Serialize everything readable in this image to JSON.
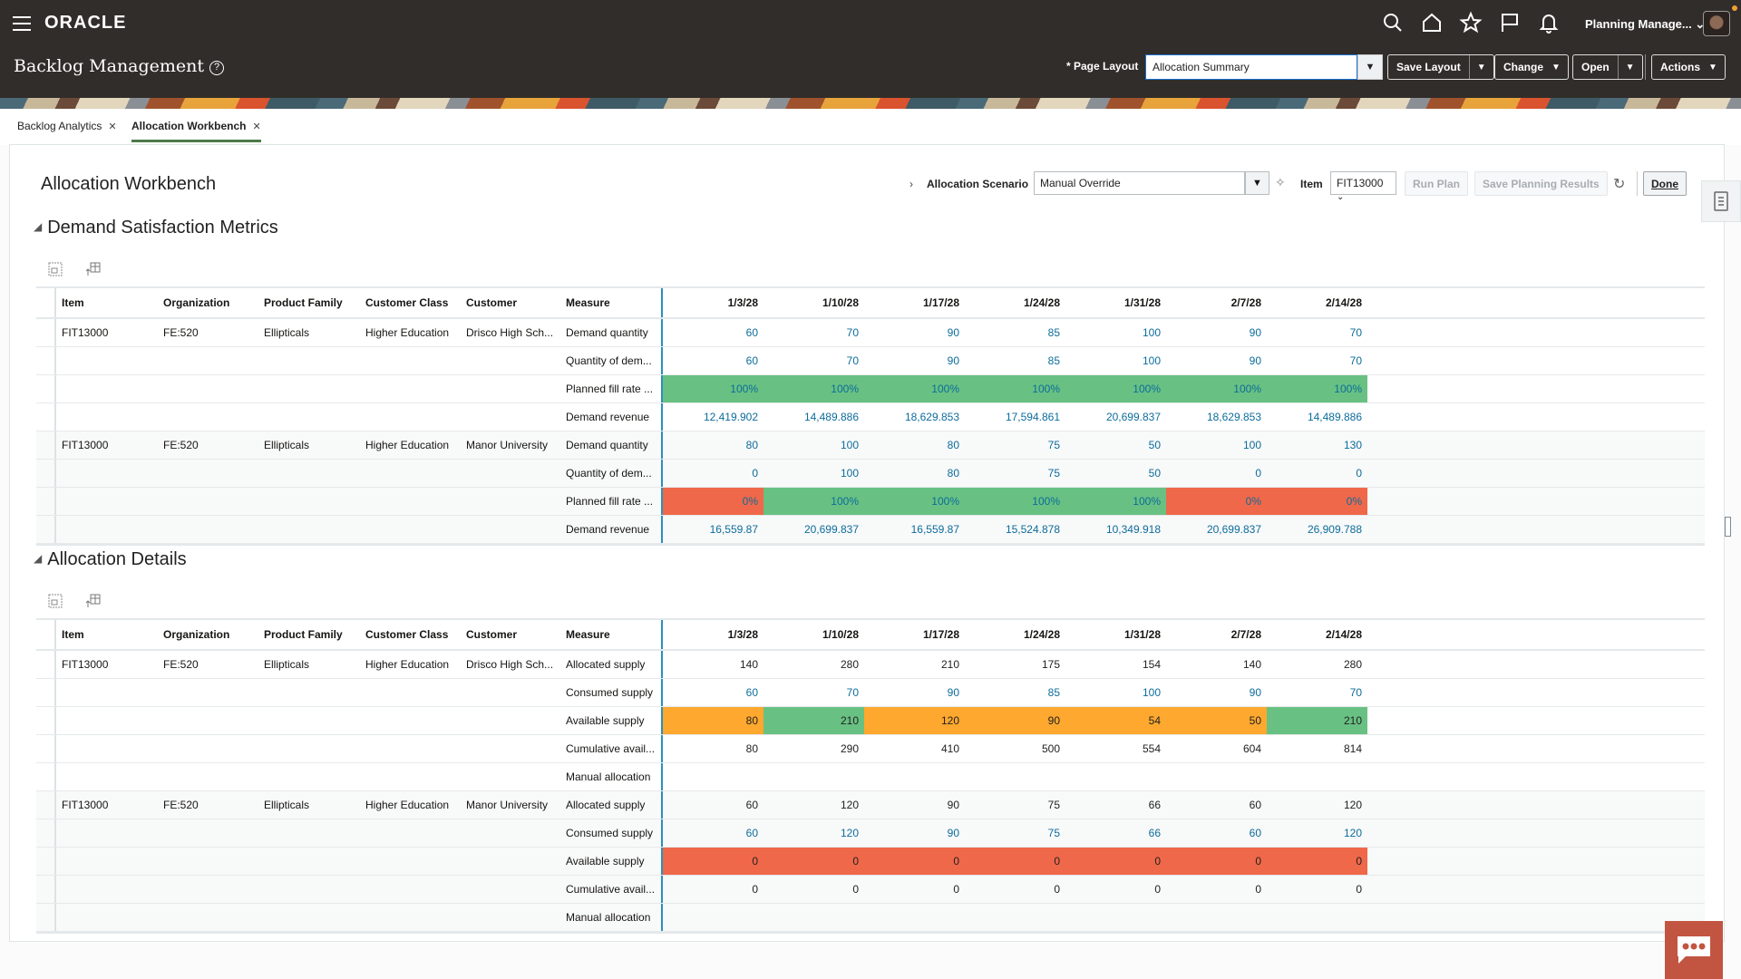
{
  "header": {
    "logo": "ORACLE",
    "page_title": "Backlog Management",
    "help_icon": "?",
    "user_name": "Planning Manage...",
    "page_layout_label": "* Page Layout",
    "page_layout_value": "Allocation Summary",
    "buttons": {
      "save_layout": "Save Layout",
      "change": "Change",
      "open": "Open",
      "actions": "Actions"
    }
  },
  "tabs": [
    {
      "label": "Backlog Analytics",
      "active": false
    },
    {
      "label": "Allocation Workbench",
      "active": true
    }
  ],
  "workbench": {
    "title": "Allocation Workbench",
    "scenario_label": "Allocation Scenario",
    "scenario_value": "Manual Override",
    "item_label": "Item",
    "item_value": "FIT13000",
    "run_plan": "Run Plan",
    "save_results": "Save Planning Results",
    "done": "Done"
  },
  "colors": {
    "green": "#68c182",
    "red": "#ef6849",
    "orange": "#fea82f",
    "link": "#0d6c9b",
    "header_bg": "#312d2a",
    "chat": "#c25541"
  },
  "columns": [
    "Item",
    "Organization",
    "Product Family",
    "Customer Class",
    "Customer",
    "Measure"
  ],
  "dates": [
    "1/3/28",
    "1/10/28",
    "1/17/28",
    "1/24/28",
    "1/31/28",
    "2/7/28",
    "2/14/28"
  ],
  "sections": [
    {
      "title": "Demand Satisfaction Metrics",
      "rows": [
        {
          "item": "FIT13000",
          "org": "FE:520",
          "family": "Ellipticals",
          "cls": "Higher Education",
          "customer": "Drisco High Sch...",
          "measure": "Demand quantity",
          "style": "link",
          "values": [
            "60",
            "70",
            "90",
            "85",
            "100",
            "90",
            "70"
          ],
          "alt": false
        },
        {
          "measure": "Quantity of dem...",
          "style": "link",
          "values": [
            "60",
            "70",
            "90",
            "85",
            "100",
            "90",
            "70"
          ],
          "alt": false
        },
        {
          "measure": "Planned fill rate ...",
          "style": "link",
          "values": [
            "100%",
            "100%",
            "100%",
            "100%",
            "100%",
            "100%",
            "100%"
          ],
          "fills": [
            "green",
            "green",
            "green",
            "green",
            "green",
            "green",
            "green"
          ],
          "alt": false
        },
        {
          "measure": "Demand revenue",
          "style": "link",
          "values": [
            "12,419.902",
            "14,489.886",
            "18,629.853",
            "17,594.861",
            "20,699.837",
            "18,629.853",
            "14,489.886"
          ],
          "alt": false
        },
        {
          "item": "FIT13000",
          "org": "FE:520",
          "family": "Ellipticals",
          "cls": "Higher Education",
          "customer": "Manor University",
          "measure": "Demand quantity",
          "style": "link",
          "values": [
            "80",
            "100",
            "80",
            "75",
            "50",
            "100",
            "130"
          ],
          "alt": true
        },
        {
          "measure": "Quantity of dem...",
          "style": "link",
          "values": [
            "0",
            "100",
            "80",
            "75",
            "50",
            "0",
            "0"
          ],
          "alt": true
        },
        {
          "measure": "Planned fill rate ...",
          "style": "link",
          "values": [
            "0%",
            "100%",
            "100%",
            "100%",
            "100%",
            "0%",
            "0%"
          ],
          "fills": [
            "red",
            "green",
            "green",
            "green",
            "green",
            "red",
            "red"
          ],
          "alt": true
        },
        {
          "measure": "Demand revenue",
          "style": "link",
          "values": [
            "16,559.87",
            "20,699.837",
            "16,559.87",
            "15,524.878",
            "10,349.918",
            "20,699.837",
            "26,909.788"
          ],
          "alt": true
        }
      ]
    },
    {
      "title": "Allocation Details",
      "rows": [
        {
          "item": "FIT13000",
          "org": "FE:520",
          "family": "Ellipticals",
          "cls": "Higher Education",
          "customer": "Drisco High Sch...",
          "measure": "Allocated supply",
          "style": "plain",
          "values": [
            "140",
            "280",
            "210",
            "175",
            "154",
            "140",
            "280"
          ],
          "alt": false
        },
        {
          "measure": "Consumed supply",
          "style": "link",
          "values": [
            "60",
            "70",
            "90",
            "85",
            "100",
            "90",
            "70"
          ],
          "alt": false
        },
        {
          "measure": "Available supply",
          "style": "plain",
          "values": [
            "80",
            "210",
            "120",
            "90",
            "54",
            "50",
            "210"
          ],
          "fills": [
            "orange",
            "green",
            "orange",
            "orange",
            "orange",
            "orange",
            "green"
          ],
          "alt": false
        },
        {
          "measure": "Cumulative avail...",
          "style": "plain",
          "values": [
            "80",
            "290",
            "410",
            "500",
            "554",
            "604",
            "814"
          ],
          "alt": false
        },
        {
          "measure": "Manual allocation",
          "style": "plain",
          "values": [
            "",
            "",
            "",
            "",
            "",
            "",
            ""
          ],
          "alt": false
        },
        {
          "item": "FIT13000",
          "org": "FE:520",
          "family": "Ellipticals",
          "cls": "Higher Education",
          "customer": "Manor University",
          "measure": "Allocated supply",
          "style": "plain",
          "values": [
            "60",
            "120",
            "90",
            "75",
            "66",
            "60",
            "120"
          ],
          "alt": true
        },
        {
          "measure": "Consumed supply",
          "style": "link",
          "values": [
            "60",
            "120",
            "90",
            "75",
            "66",
            "60",
            "120"
          ],
          "alt": true
        },
        {
          "measure": "Available supply",
          "style": "plain",
          "values": [
            "0",
            "0",
            "0",
            "0",
            "0",
            "0",
            "0"
          ],
          "fills": [
            "red",
            "red",
            "red",
            "red",
            "red",
            "red",
            "red"
          ],
          "alt": true
        },
        {
          "measure": "Cumulative avail...",
          "style": "plain",
          "values": [
            "0",
            "0",
            "0",
            "0",
            "0",
            "0",
            "0"
          ],
          "alt": true
        },
        {
          "measure": "Manual allocation",
          "style": "plain",
          "values": [
            "",
            "",
            "",
            "",
            "",
            "",
            ""
          ],
          "alt": true
        }
      ]
    }
  ]
}
